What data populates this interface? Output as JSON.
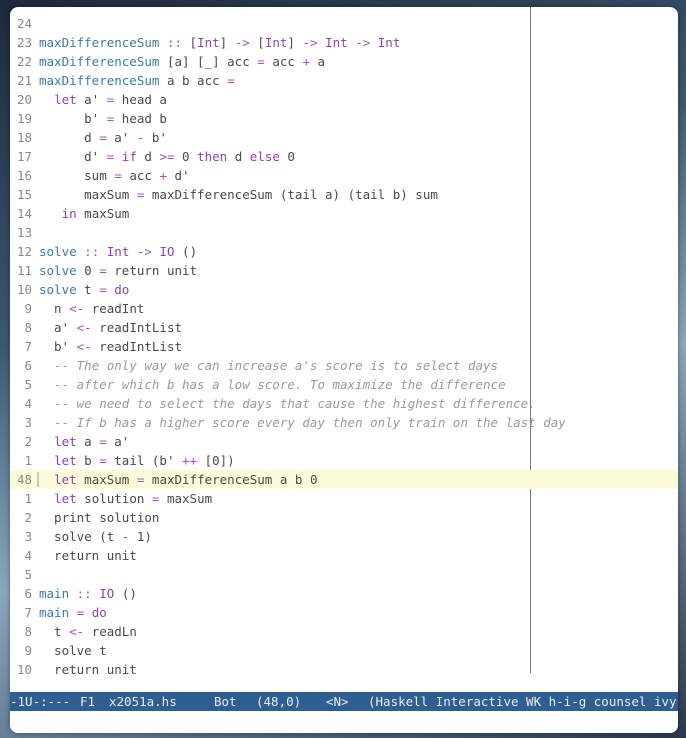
{
  "editor": {
    "lines": [
      {
        "num": "24",
        "code": ""
      },
      {
        "num": "23",
        "code": "maxDifferenceSum :: [Int] -> [Int] -> Int -> Int"
      },
      {
        "num": "22",
        "code": "maxDifferenceSum [a] [_] acc = acc + a"
      },
      {
        "num": "21",
        "code": "maxDifferenceSum a b acc ="
      },
      {
        "num": "20",
        "code": "  let a' = head a"
      },
      {
        "num": "19",
        "code": "      b' = head b"
      },
      {
        "num": "18",
        "code": "      d = a' - b'"
      },
      {
        "num": "17",
        "code": "      d' = if d >= 0 then d else 0"
      },
      {
        "num": "16",
        "code": "      sum = acc + d'"
      },
      {
        "num": "15",
        "code": "      maxSum = maxDifferenceSum (tail a) (tail b) sum"
      },
      {
        "num": "14",
        "code": "   in maxSum"
      },
      {
        "num": "13",
        "code": ""
      },
      {
        "num": "12",
        "code": "solve :: Int -> IO ()"
      },
      {
        "num": "11",
        "code": "solve 0 = return unit"
      },
      {
        "num": "10",
        "code": "solve t = do"
      },
      {
        "num": "9",
        "code": "  n <- readInt"
      },
      {
        "num": "8",
        "code": "  a' <- readIntList"
      },
      {
        "num": "7",
        "code": "  b' <- readIntList"
      },
      {
        "num": "6",
        "code": "  -- The only way we can increase a's score is to select days"
      },
      {
        "num": "5",
        "code": "  -- after which b has a low score. To maximize the difference"
      },
      {
        "num": "4",
        "code": "  -- we need to select the days that cause the highest difference."
      },
      {
        "num": "3",
        "code": "  -- If b has a higher score every day then only train on the last day"
      },
      {
        "num": "2",
        "code": "  let a = a'"
      },
      {
        "num": "1",
        "code": "  let b = tail (b' ++ [0])"
      },
      {
        "num": "48",
        "code": "  let maxSum = maxDifferenceSum a b 0",
        "current": true
      },
      {
        "num": "1",
        "code": "  let solution = maxSum"
      },
      {
        "num": "2",
        "code": "  print solution"
      },
      {
        "num": "3",
        "code": "  solve (t - 1)"
      },
      {
        "num": "4",
        "code": "  return unit"
      },
      {
        "num": "5",
        "code": ""
      },
      {
        "num": "6",
        "code": "main :: IO ()"
      },
      {
        "num": "7",
        "code": "main = do"
      },
      {
        "num": "8",
        "code": "  t <- readLn"
      },
      {
        "num": "9",
        "code": "  solve t"
      },
      {
        "num": "10",
        "code": "  return unit"
      }
    ]
  },
  "modeline": {
    "status": "-1U-:---",
    "frame": "F1",
    "filename": "x2051a.hs",
    "position": "Bot",
    "cursor": "(48,0)",
    "evil_state": "<N>",
    "modes": "(Haskell Interactive WK h-i-g counsel ivy) -"
  },
  "colors": {
    "modeline_bg": "#2f5e93",
    "current_line_bg": "#fbfbd8",
    "function": "#3a7ab0",
    "keyword": "#8e3fb5",
    "comment": "#9a9a9a"
  }
}
